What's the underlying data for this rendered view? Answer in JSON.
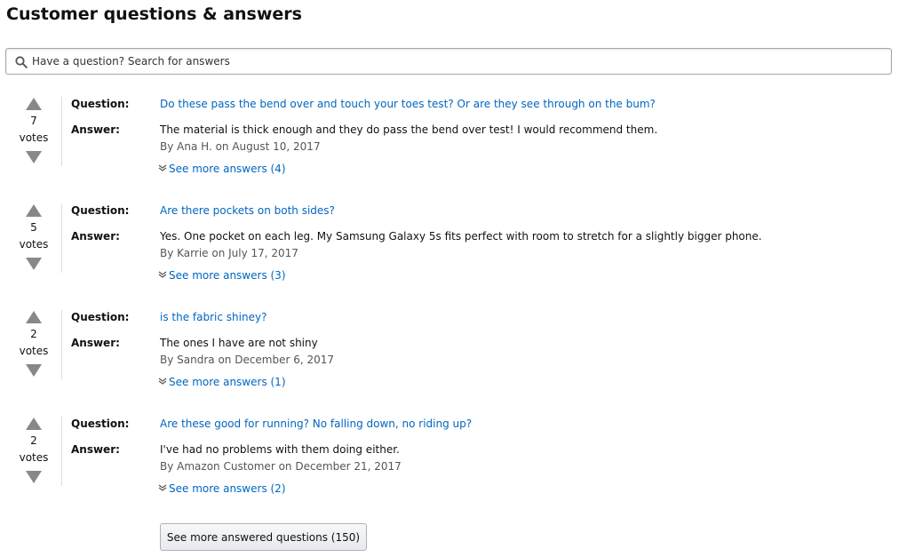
{
  "header": {
    "title": "Customer questions & answers"
  },
  "search": {
    "placeholder": "Have a question? Search for answers",
    "value": ""
  },
  "labels": {
    "question": "Question:",
    "answer": "Answer:",
    "votes": "votes"
  },
  "colors": {
    "link": "#0066c0",
    "text": "#111111",
    "muted": "#555555",
    "arrow": "#888888",
    "border": "#a6a6a6"
  },
  "questions": [
    {
      "votes": "7",
      "question": "Do these pass the bend over and touch your toes test? Or are they see through on the bum?",
      "answer": "The material is thick enough and they do pass the bend over test! I would recommend them.",
      "byline": "By Ana H. on August 10, 2017",
      "more": "See more answers (4)"
    },
    {
      "votes": "5",
      "question": "Are there pockets on both sides?",
      "answer": "Yes. One pocket on each leg. My Samsung Galaxy 5s fits perfect with room to stretch for a slightly bigger phone.",
      "byline": "By Karrie on July 17, 2017",
      "more": "See more answers (3)"
    },
    {
      "votes": "2",
      "question": "is the fabric shiney?",
      "answer": "The ones I have are not shiny",
      "byline": "By Sandra on December 6, 2017",
      "more": "See more answers (1)"
    },
    {
      "votes": "2",
      "question": "Are these good for running? No falling down, no riding up?",
      "answer": "I've had no problems with them doing either.",
      "byline": "By Amazon Customer on December 21, 2017",
      "more": "See more answers (2)"
    }
  ],
  "footer": {
    "more_questions_label": "See more answered questions (150)"
  }
}
